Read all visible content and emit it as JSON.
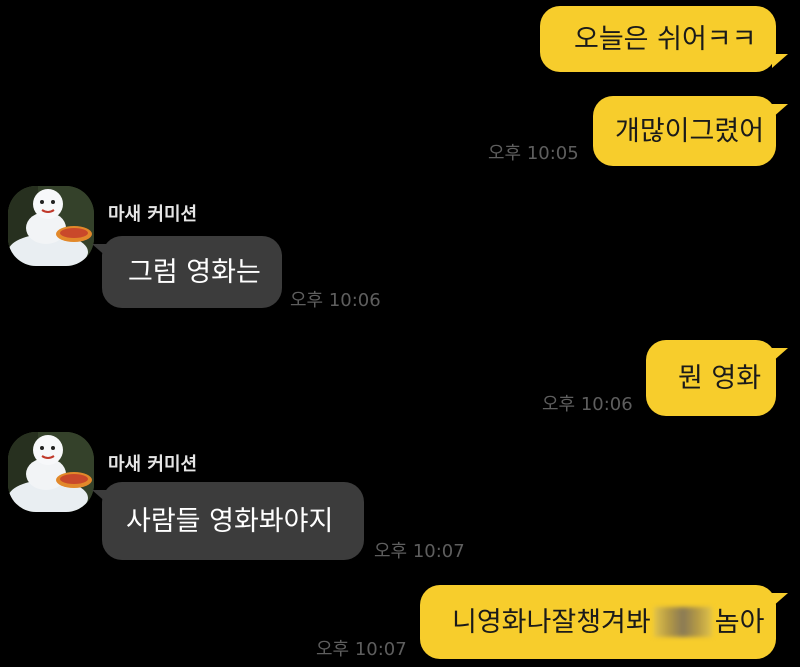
{
  "messages": [
    {
      "from": "me",
      "text": "오늘은 쉬어ㅋㅋ"
    },
    {
      "from": "me",
      "text": "개많이그렸어",
      "time": "오후 10:05"
    },
    {
      "from": "them",
      "sender": "마새 커미션",
      "text": "그럼 영화는",
      "time": "오후 10:06"
    },
    {
      "from": "me",
      "text": "뭔 영화",
      "time": "오후 10:06"
    },
    {
      "from": "them",
      "sender": "마새 커미션",
      "text": "사람들 영화봐야지",
      "time": "오후 10:07"
    },
    {
      "from": "me",
      "text_before": "니영화나잘챙겨봐",
      "text_after": "놈아",
      "time": "오후 10:07"
    }
  ],
  "colors": {
    "background": "#000000",
    "my_bubble": "#f7cd2c",
    "their_bubble": "#3c3c3c",
    "timestamp": "#5e5e5e"
  },
  "icons": {
    "avatar": "snowman-with-pizza-avatar"
  }
}
